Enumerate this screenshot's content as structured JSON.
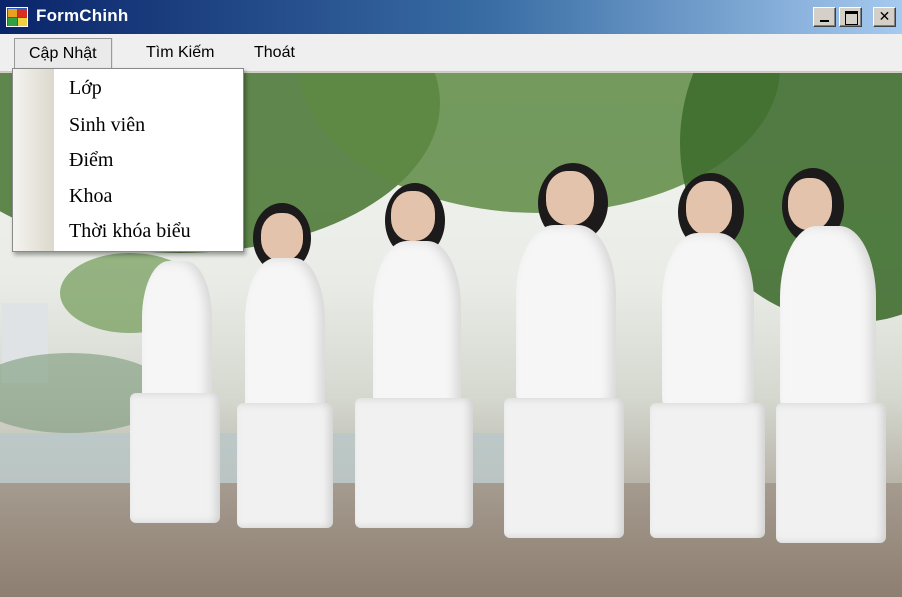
{
  "window": {
    "title": "FormChinh",
    "controls": {
      "minimize": "minimize",
      "maximize": "maximize",
      "close": "✕"
    }
  },
  "menubar": {
    "items": [
      {
        "label": "Cập Nhật"
      },
      {
        "label": "Tìm Kiếm"
      },
      {
        "label": "Thoát"
      }
    ]
  },
  "dropdown": {
    "items": [
      {
        "label": "Lớp"
      },
      {
        "label": "Sinh viên"
      },
      {
        "label": "Điểm"
      },
      {
        "label": "Khoa"
      },
      {
        "label": "Thời khóa biểu"
      }
    ]
  },
  "colors": {
    "titlebar_start": "#0a246a",
    "titlebar_end": "#a6caf0",
    "menubar_bg": "#efefef",
    "dropdown_bg": "#ffffff"
  },
  "icons": {
    "app": "windows-form-icon"
  }
}
